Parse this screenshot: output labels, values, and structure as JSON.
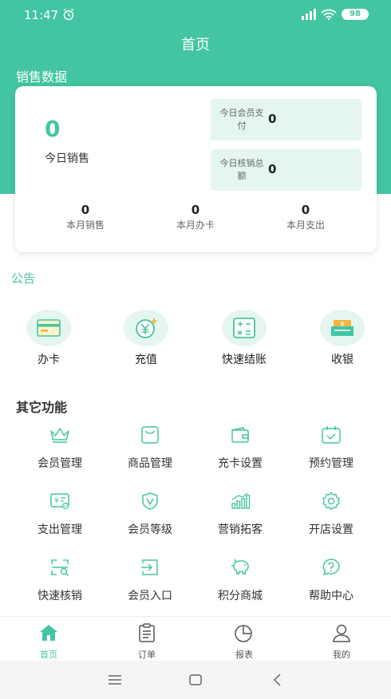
{
  "status": {
    "time": "11:47",
    "battery": "98"
  },
  "header": {
    "title": "首页"
  },
  "sales": {
    "section_title": "销售数据",
    "today_value": "0",
    "today_label": "今日销售",
    "member_pay_label": "今日会员支付",
    "member_pay_value": "0",
    "writeoff_label": "今日核销总额",
    "writeoff_value": "0",
    "month": [
      {
        "value": "0",
        "label": "本月销售"
      },
      {
        "value": "0",
        "label": "本月办卡"
      },
      {
        "value": "0",
        "label": "本月支出"
      }
    ]
  },
  "notice": {
    "title": "公告"
  },
  "quick_actions": [
    {
      "label": "办卡",
      "icon": "card-icon"
    },
    {
      "label": "充值",
      "icon": "yuan-plus-icon"
    },
    {
      "label": "快速结账",
      "icon": "calculator-icon"
    },
    {
      "label": "收银",
      "icon": "cashier-icon"
    }
  ],
  "other": {
    "title": "其它功能",
    "items": [
      {
        "label": "会员管理",
        "icon": "crown-icon"
      },
      {
        "label": "商品管理",
        "icon": "bag-icon"
      },
      {
        "label": "充卡设置",
        "icon": "wallet-icon"
      },
      {
        "label": "预约管理",
        "icon": "calendar-check-icon"
      },
      {
        "label": "支出管理",
        "icon": "expense-icon"
      },
      {
        "label": "会员等级",
        "icon": "shield-v-icon"
      },
      {
        "label": "营销拓客",
        "icon": "bar-chart-icon"
      },
      {
        "label": "开店设置",
        "icon": "gear-icon"
      },
      {
        "label": "快速核销",
        "icon": "scan-search-icon"
      },
      {
        "label": "会员入口",
        "icon": "login-icon"
      },
      {
        "label": "积分商城",
        "icon": "piggy-bank-icon"
      },
      {
        "label": "帮助中心",
        "icon": "help-icon"
      }
    ]
  },
  "bottom_nav": [
    {
      "label": "首页",
      "icon": "home-icon",
      "active": true
    },
    {
      "label": "订单",
      "icon": "clipboard-icon",
      "active": false
    },
    {
      "label": "报表",
      "icon": "pie-chart-icon",
      "active": false
    },
    {
      "label": "我的",
      "icon": "user-icon",
      "active": false
    }
  ],
  "colors": {
    "primary": "#43c5a2",
    "light": "#e5f6f0"
  }
}
